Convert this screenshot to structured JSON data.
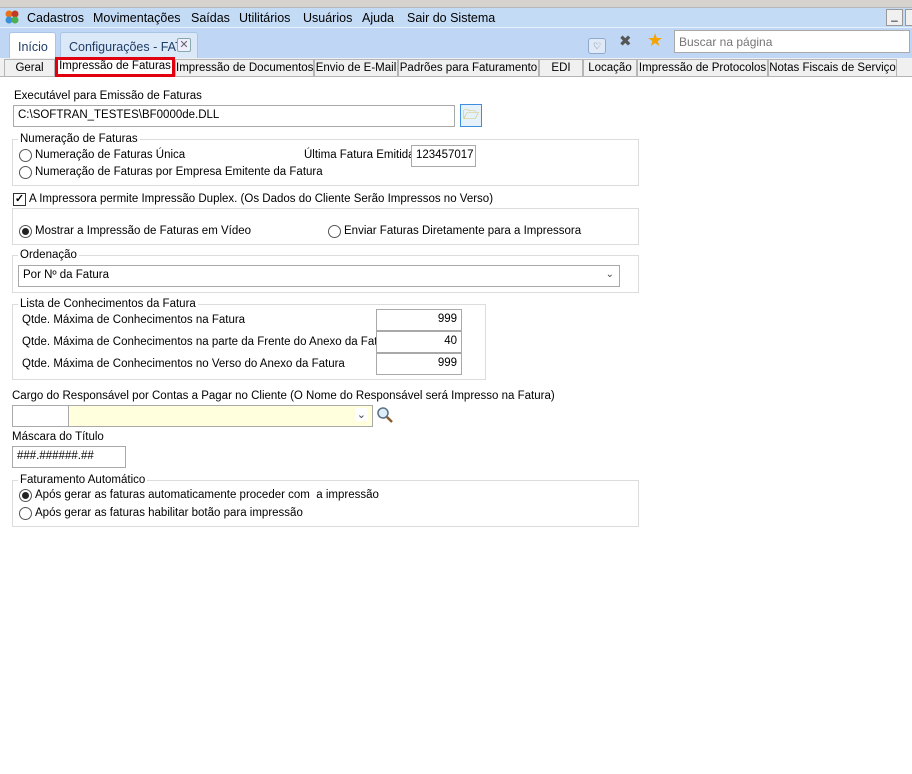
{
  "menu": {
    "items": [
      "Cadastros",
      "Movimentações",
      "Saídas",
      "Utilitários",
      "Usuários",
      "Ajuda",
      "Sair do Sistema"
    ]
  },
  "doc_tabs": [
    "Início",
    "Configurações - FAT"
  ],
  "search": {
    "placeholder": "Buscar na página"
  },
  "sub_tabs": [
    "Geral",
    "Impressão de Faturas",
    "Impressão de Documentos",
    "Envio de E-Mail",
    "Padrões para Faturamento",
    "EDI",
    "Locação",
    "Impressão de Protocolos",
    "Notas Fiscais de Serviço"
  ],
  "form": {
    "exe_label": "Executável para Emissão de Faturas",
    "exe_value": "C:\\SOFTRAN_TESTES\\BF0000de.DLL",
    "numeracao": {
      "legend": "Numeração de Faturas",
      "options": [
        "Numeração de Faturas Única",
        "Numeração de Faturas por Empresa Emitente da Fatura"
      ],
      "selected": null,
      "ultima_label": "Última Fatura Emitida",
      "ultima_value": "123457017"
    },
    "duplex": {
      "label": "A Impressora permite Impressão Duplex. (Os Dados do Cliente Serão Impressos no Verso)",
      "checked": true
    },
    "saida": {
      "options": [
        "Mostrar a Impressão de Faturas em Vídeo",
        "Enviar Faturas Diretamente para a Impressora"
      ],
      "selected": 0
    },
    "ordenacao": {
      "legend": "Ordenação",
      "value": "Por Nº da Fatura"
    },
    "lista": {
      "legend": "Lista de Conhecimentos da Fatura",
      "rows": [
        {
          "label": "Qtde. Máxima de Conhecimentos na Fatura",
          "value": "999"
        },
        {
          "label": "Qtde. Máxima de Conhecimentos na parte da Frente do Anexo da Fatura",
          "value": "40"
        },
        {
          "label": "Qtde. Máxima de Conhecimentos no Verso do Anexo da Fatura",
          "value": "999"
        }
      ]
    },
    "cargo": {
      "label": "Cargo do Responsável por Contas a Pagar no Cliente (O Nome do Responsável será Impresso na Fatura)",
      "code": "",
      "value": ""
    },
    "mascara": {
      "label": "Máscara do Título",
      "value": "###.######.##"
    },
    "fat_auto": {
      "legend": "Faturamento Automático",
      "options": [
        "Após gerar as faturas automaticamente proceder com  a impressão",
        "Após gerar as faturas habilitar botão para impressão"
      ],
      "selected": 0
    }
  },
  "colors": {
    "active_tab_highlight": "#e0000f",
    "combo_bg": "#ffffdd",
    "star": "#f5a300"
  }
}
